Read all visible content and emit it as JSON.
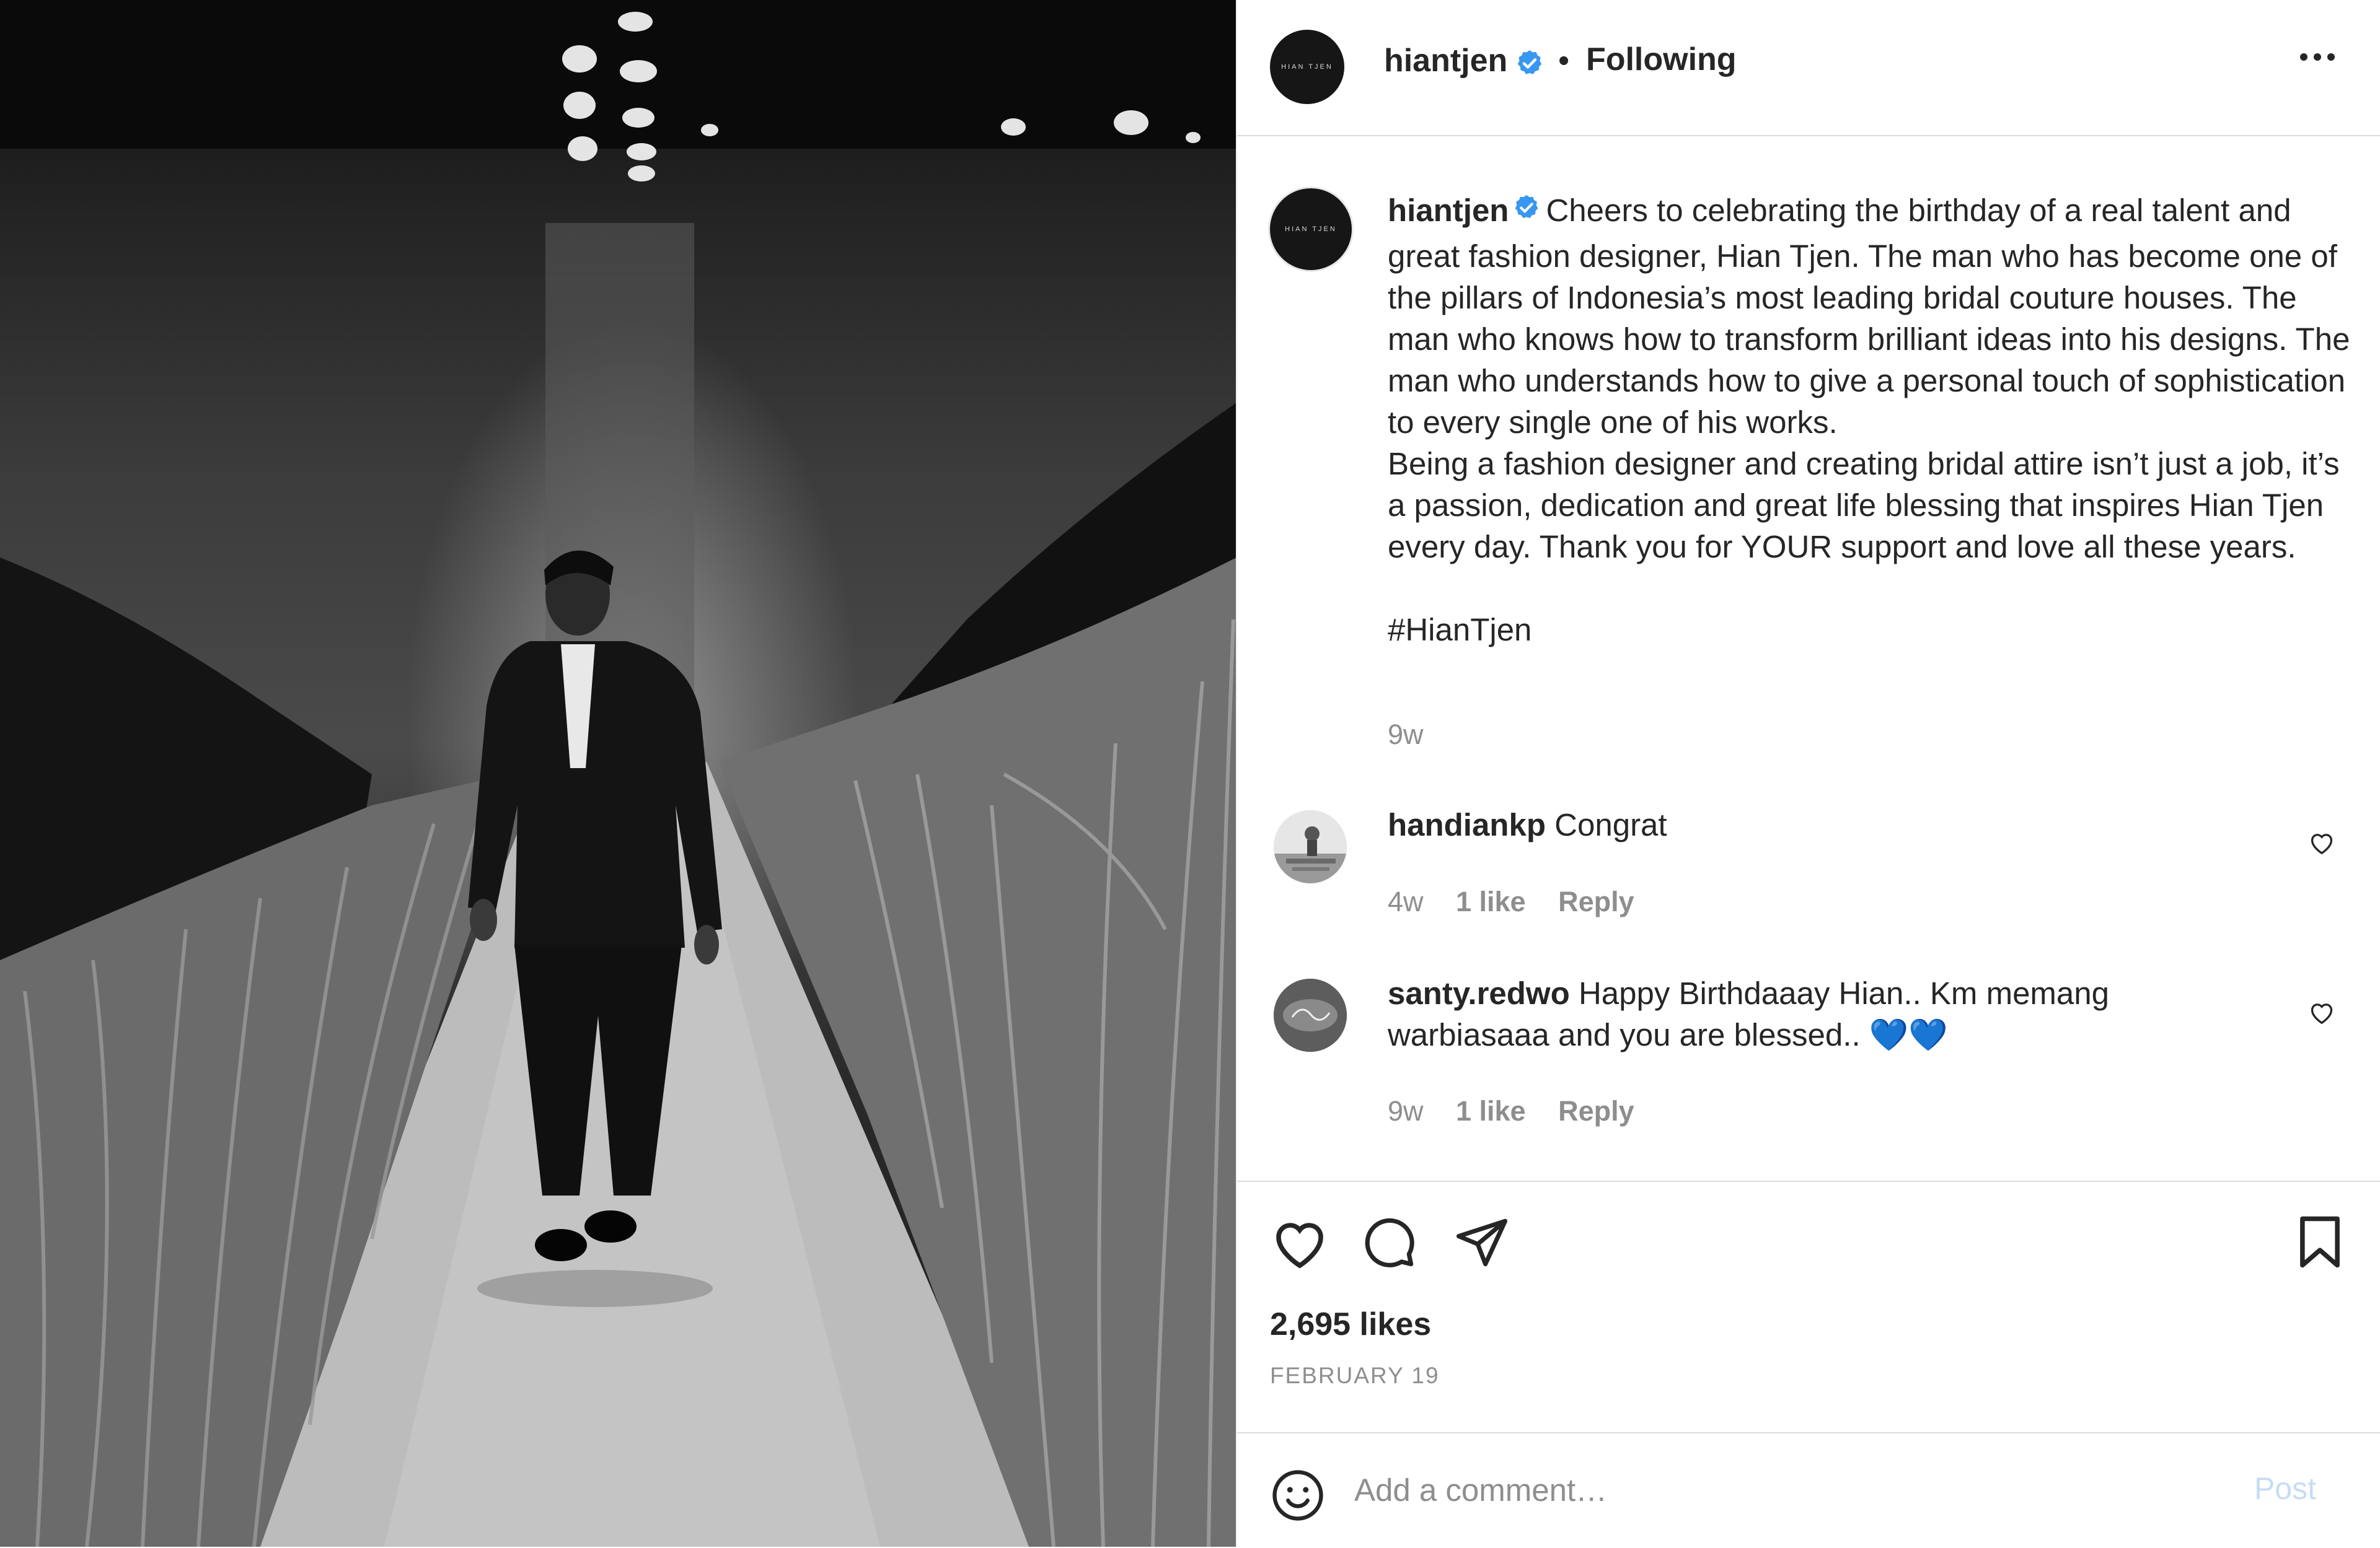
{
  "header": {
    "avatar_text": "HIAN TJEN",
    "username": "hiantjen",
    "separator": "•",
    "follow_status": "Following"
  },
  "caption": {
    "avatar_text": "HIAN TJEN",
    "username": "hiantjen",
    "text": "Cheers to celebrating the birthday of a real talent and great fashion designer, Hian Tjen. The man who has become one of the pillars of Indonesia’s most leading bridal couture houses. The man who knows how to transform brilliant ideas into his designs. The man who understands how to give a personal touch of sophistication to every single one of his works.\nBeing a fashion designer and creating bridal attire isn’t just a job, it’s a passion, dedication and great life blessing that inspires Hian Tjen every day. Thank you for YOUR support and love all these years.\n\n#HianTjen",
    "time": "9w"
  },
  "comments": [
    {
      "username": "handiankp",
      "text": "Congrat",
      "time": "4w",
      "likes": "1 like",
      "reply": "Reply"
    },
    {
      "username": "santy.redwo",
      "text": "Happy Birthdaaay Hian.. Km memang warbiasaaa and you are blessed.. 💙💙",
      "time": "9w",
      "likes": "1 like",
      "reply": "Reply"
    }
  ],
  "actions": {
    "likes": "2,695 likes",
    "date": "FEBRUARY 19"
  },
  "add_comment": {
    "placeholder": "Add a comment…",
    "post_label": "Post"
  },
  "colors": {
    "verified": "#3897f0",
    "secondary_text": "#8e8e8e",
    "post_disabled": "#c7dcf5"
  }
}
